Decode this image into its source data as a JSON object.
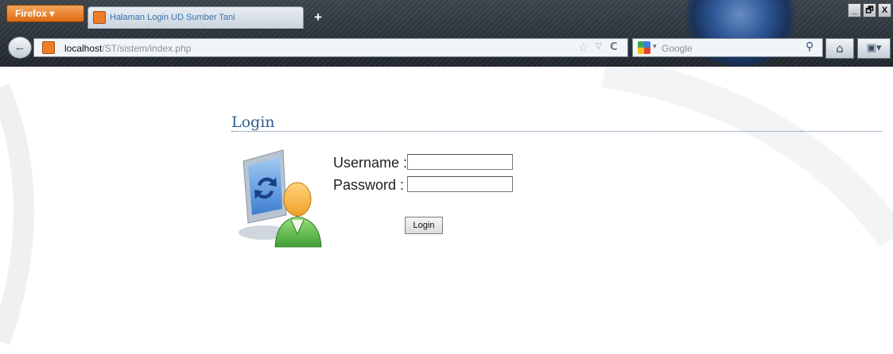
{
  "browser": {
    "menu_button_label": "Firefox ▾",
    "tab_title": "Halaman Login UD Sumber Tani",
    "new_tab_label": "+",
    "window_buttons": [
      "_",
      "🗗",
      "X"
    ],
    "url_host": "localhost",
    "url_path": "/ST/sistem/index.php",
    "search_placeholder": "Google"
  },
  "page": {
    "heading": "Login",
    "form": {
      "username_label": "Username :",
      "password_label": "Password  :",
      "username_value": "",
      "password_value": "",
      "submit_label": "Login"
    }
  },
  "icons": {
    "back": "back-arrow-icon",
    "tab_favicon": "xampp-favicon-icon",
    "bookmark_star": "star-icon",
    "reload": "reload-icon",
    "search_engine": "google-icon",
    "search": "magnifier-icon",
    "home": "home-icon",
    "bookmarks": "bookmarks-icon",
    "illustration": "user-computer-sync-icon"
  },
  "colors": {
    "heading": "#2f5f8f",
    "firefox_button": "#e06a12",
    "chrome_background": "#2b3138"
  }
}
